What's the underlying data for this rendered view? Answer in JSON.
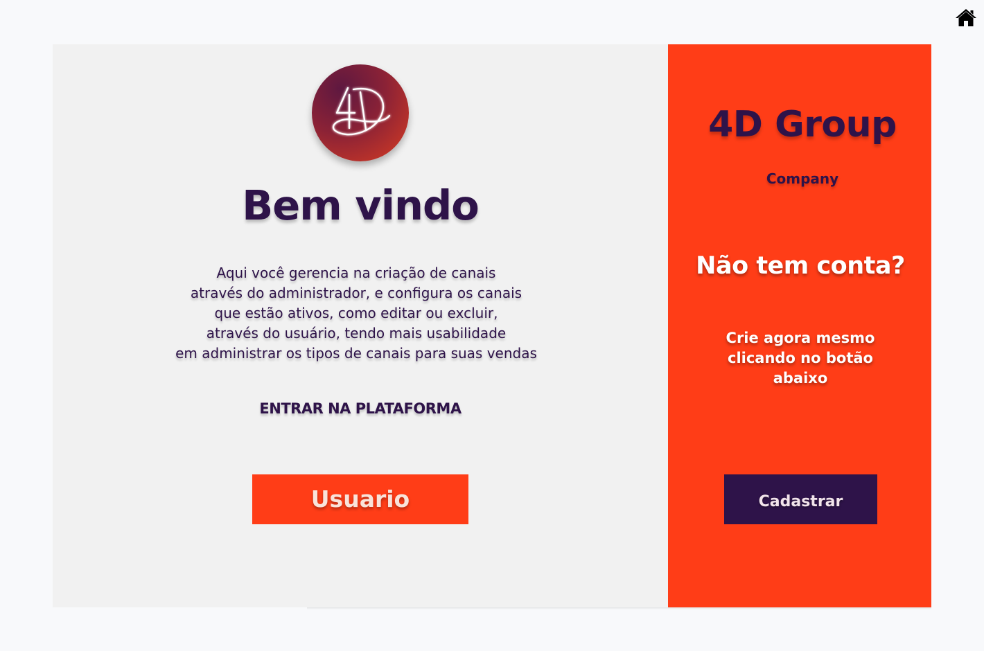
{
  "header": {
    "home_icon": "home-icon"
  },
  "welcome": {
    "logo_text": "4D",
    "title": "Bem vindo",
    "description_lines": [
      "Aqui você gerencia na criação de canais",
      "através do administrador, e configura os canais",
      "que estão ativos, como editar ou excluir,",
      "através do usuário, tendo mais usabilidade",
      "em administrar os tipos de canais para suas vendas"
    ],
    "enter_label": "ENTRAR NA PLATAFORMA",
    "user_button_label": "Usuario"
  },
  "signup": {
    "brand_title": "4D Group",
    "brand_subtitle": "Company",
    "heading": "Não tem conta?",
    "text_lines": [
      "Crie agora mesmo",
      "clicando no botão",
      "abaixo"
    ],
    "register_button_label": "Cadastrar"
  },
  "colors": {
    "accent": "#ff3d17",
    "brand_dark": "#2e1349",
    "panel_light": "#f1f1f1",
    "page_bg": "#f8f9fb"
  }
}
